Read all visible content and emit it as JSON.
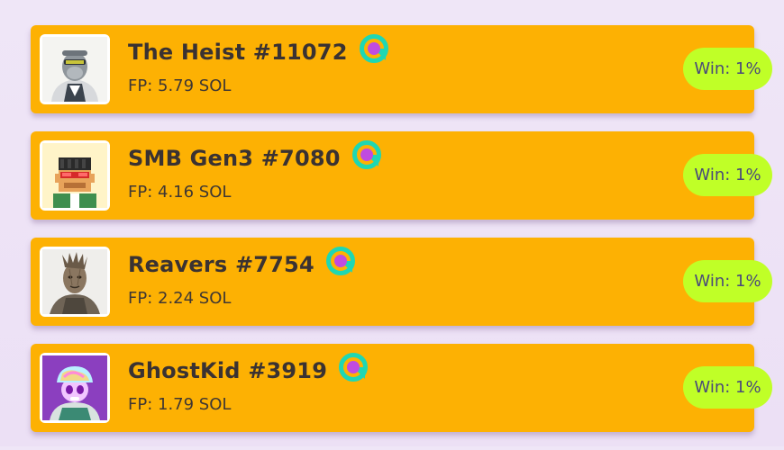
{
  "colors": {
    "card_background": "#fdb103",
    "win_pill": "#c0ff27",
    "page_background": "#efe6f7"
  },
  "items": [
    {
      "name": "The Heist #11072",
      "fp": "FP: 5.79 SOL",
      "win": "Win: 1%",
      "avatar_icon": "gorilla-avatar-icon",
      "badge_icon": "verified-collection-icon"
    },
    {
      "name": "SMB Gen3 #7080",
      "fp": "FP: 4.16 SOL",
      "win": "Win: 1%",
      "avatar_icon": "pixel-monkey-avatar-icon",
      "badge_icon": "verified-collection-icon"
    },
    {
      "name": "Reavers #7754",
      "fp": "FP: 2.24 SOL",
      "win": "Win: 1%",
      "avatar_icon": "tree-creature-avatar-icon",
      "badge_icon": "verified-collection-icon"
    },
    {
      "name": "GhostKid #3919",
      "fp": "FP: 1.79 SOL",
      "win": "Win: 1%",
      "avatar_icon": "ghost-kid-avatar-icon",
      "badge_icon": "verified-collection-icon"
    }
  ]
}
